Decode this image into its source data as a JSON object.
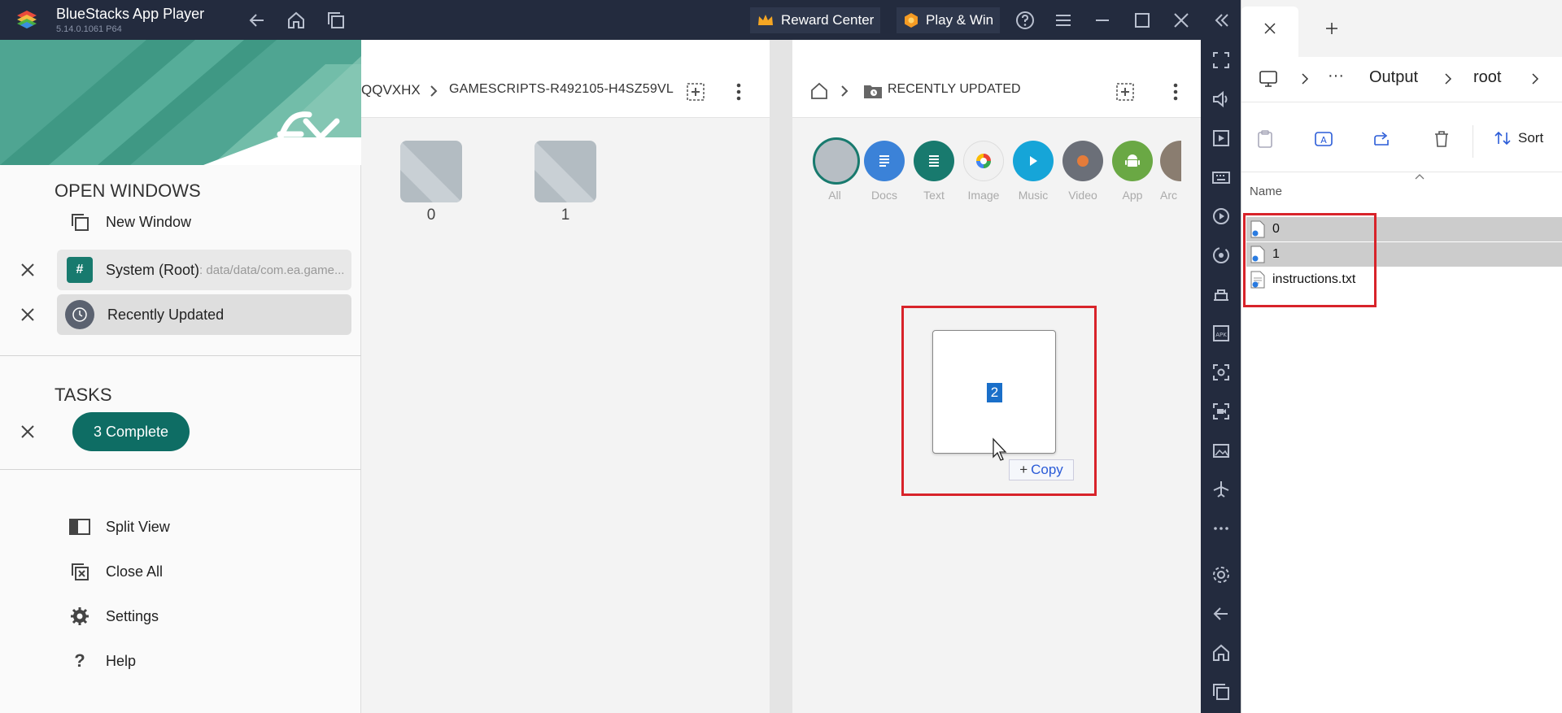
{
  "bluestacks": {
    "title": "BlueStacks App Player",
    "version": "5.14.0.1061  P64",
    "reward_center": "Reward Center",
    "play_win": "Play & Win"
  },
  "drawer": {
    "open_windows_title": "OPEN WINDOWS",
    "new_window": "New Window",
    "windows": [
      {
        "title": "System (Root)",
        "subtitle": ": data/data/com.ea.game...",
        "badge": "#"
      },
      {
        "title": "Recently Updated",
        "subtitle": ""
      }
    ],
    "tasks_title": "TASKS",
    "task_status": "3 Complete",
    "menu": [
      {
        "label": "Split View",
        "icon": "split-view-icon"
      },
      {
        "label": "Close All",
        "icon": "close-all-icon"
      },
      {
        "label": "Settings",
        "icon": "gear-icon"
      },
      {
        "label": "Help",
        "icon": "help-icon"
      }
    ]
  },
  "left_pane": {
    "breadcrumb_prev": "QQVXHX",
    "breadcrumb_current": "GAMESCRIPTS-R492105-H4SZ59VL",
    "folders": [
      "0",
      "1"
    ]
  },
  "right_pane": {
    "breadcrumb": "RECENTLY UPDATED",
    "categories": [
      {
        "label": "All",
        "color": "#b7bec4"
      },
      {
        "label": "Docs",
        "color": "#3b82d8"
      },
      {
        "label": "Text",
        "color": "#187a6e"
      },
      {
        "label": "Image",
        "color": "#f1f1f1"
      },
      {
        "label": "Music",
        "color": "#16a5d8"
      },
      {
        "label": "Video",
        "color": "#6b6f78"
      },
      {
        "label": "App",
        "color": "#6aa844"
      },
      {
        "label": "Arc",
        "color": "#8a7d70"
      }
    ],
    "drag_item": "2",
    "copy_tip": "Copy"
  },
  "explorer": {
    "address": [
      "Output",
      "root"
    ],
    "sort_label": "Sort",
    "column_name": "Name",
    "files": [
      {
        "name": "0",
        "selected": true
      },
      {
        "name": "1",
        "selected": true
      },
      {
        "name": "instructions.txt",
        "selected": false
      }
    ]
  },
  "colors": {
    "accent_teal": "#0e6d64",
    "highlight_red": "#d8232a",
    "titlebar": "#232b3e"
  }
}
